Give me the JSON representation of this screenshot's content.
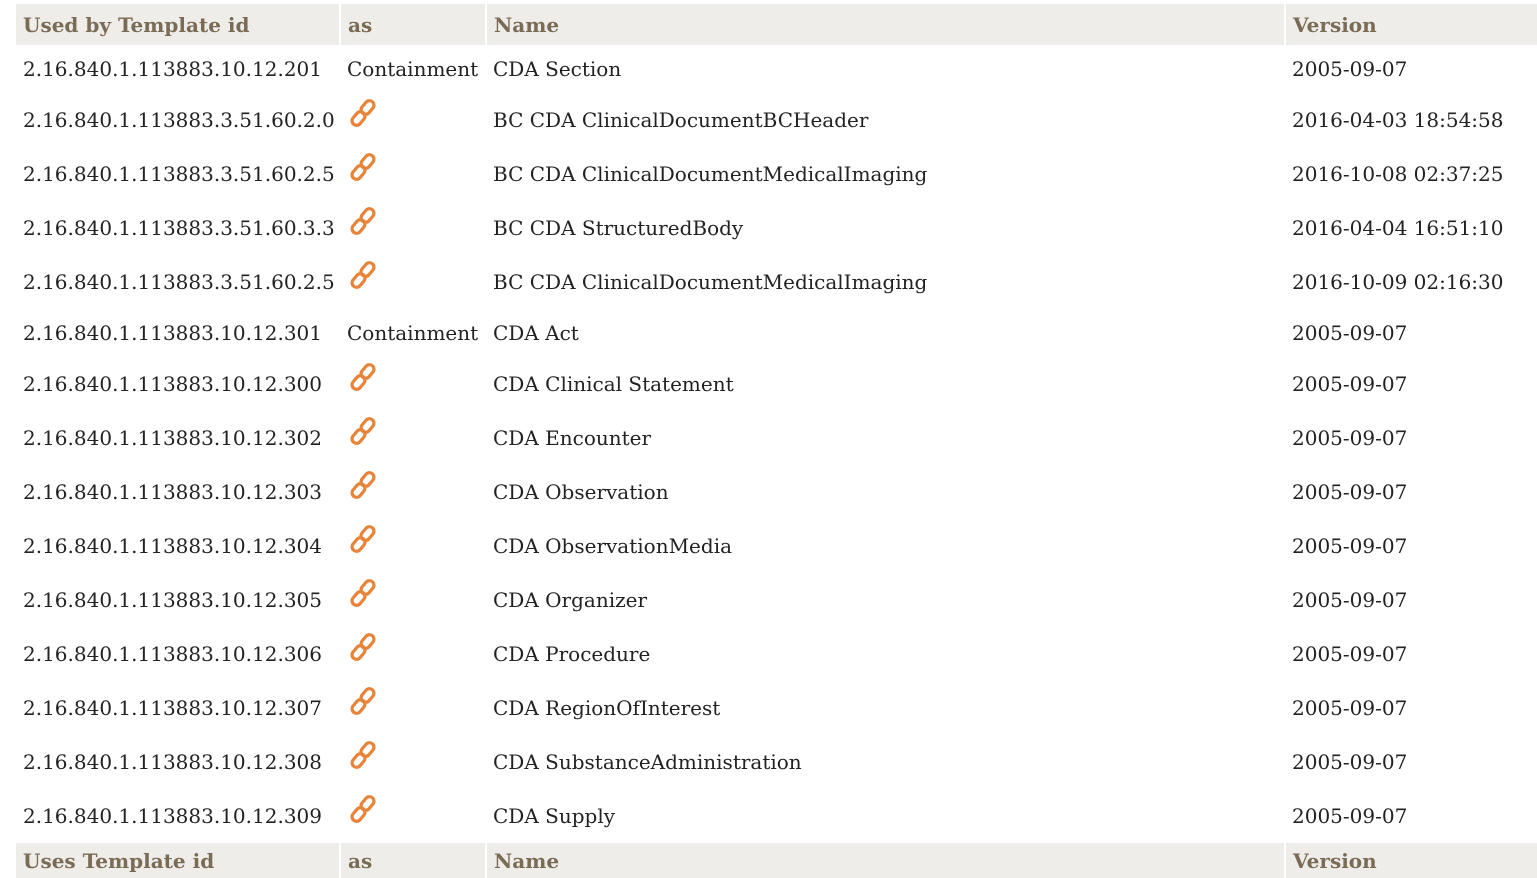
{
  "used_by_header": {
    "template_id": "Used by Template id",
    "as": "as",
    "name": "Name",
    "version": "Version"
  },
  "used_by_rows": [
    {
      "template_id": "2.16.840.1.113883.10.12.201",
      "as": "Containment",
      "as_icon": "",
      "name": "CDA Section",
      "version": "2005-09-07"
    },
    {
      "template_id": "2.16.840.1.113883.3.51.60.2.0",
      "as": "",
      "as_icon": "link-icon",
      "name": "BC CDA ClinicalDocumentBCHeader",
      "version": "2016-04-03 18:54:58"
    },
    {
      "template_id": "2.16.840.1.113883.3.51.60.2.5",
      "as": "",
      "as_icon": "link-icon",
      "name": "BC CDA ClinicalDocumentMedicalImaging",
      "version": "2016-10-08 02:37:25"
    },
    {
      "template_id": "2.16.840.1.113883.3.51.60.3.3",
      "as": "",
      "as_icon": "link-icon",
      "name": "BC CDA StructuredBody",
      "version": "2016-04-04 16:51:10"
    },
    {
      "template_id": "2.16.840.1.113883.3.51.60.2.5",
      "as": "",
      "as_icon": "link-icon",
      "name": "BC CDA ClinicalDocumentMedicalImaging",
      "version": "2016-10-09 02:16:30"
    },
    {
      "template_id": "2.16.840.1.113883.10.12.301",
      "as": "Containment",
      "as_icon": "",
      "name": "CDA Act",
      "version": "2005-09-07"
    },
    {
      "template_id": "2.16.840.1.113883.10.12.300",
      "as": "",
      "as_icon": "link-icon",
      "name": "CDA Clinical Statement",
      "version": "2005-09-07"
    },
    {
      "template_id": "2.16.840.1.113883.10.12.302",
      "as": "",
      "as_icon": "link-icon",
      "name": "CDA Encounter",
      "version": "2005-09-07"
    },
    {
      "template_id": "2.16.840.1.113883.10.12.303",
      "as": "",
      "as_icon": "link-icon",
      "name": "CDA Observation",
      "version": "2005-09-07"
    },
    {
      "template_id": "2.16.840.1.113883.10.12.304",
      "as": "",
      "as_icon": "link-icon",
      "name": "CDA ObservationMedia",
      "version": "2005-09-07"
    },
    {
      "template_id": "2.16.840.1.113883.10.12.305",
      "as": "",
      "as_icon": "link-icon",
      "name": "CDA Organizer",
      "version": "2005-09-07"
    },
    {
      "template_id": "2.16.840.1.113883.10.12.306",
      "as": "",
      "as_icon": "link-icon",
      "name": "CDA Procedure",
      "version": "2005-09-07"
    },
    {
      "template_id": "2.16.840.1.113883.10.12.307",
      "as": "",
      "as_icon": "link-icon",
      "name": "CDA RegionOfInterest",
      "version": "2005-09-07"
    },
    {
      "template_id": "2.16.840.1.113883.10.12.308",
      "as": "",
      "as_icon": "link-icon",
      "name": "CDA SubstanceAdministration",
      "version": "2005-09-07"
    },
    {
      "template_id": "2.16.840.1.113883.10.12.309",
      "as": "",
      "as_icon": "link-icon",
      "name": "CDA Supply",
      "version": "2005-09-07"
    }
  ],
  "uses_header": {
    "template_id": "Uses Template id",
    "as": "as",
    "name": "Name",
    "version": "Version"
  },
  "colors": {
    "header_bg": "#efedea",
    "header_text": "#7a6b55",
    "link_icon": "#e8833a",
    "body_text": "#222222"
  }
}
